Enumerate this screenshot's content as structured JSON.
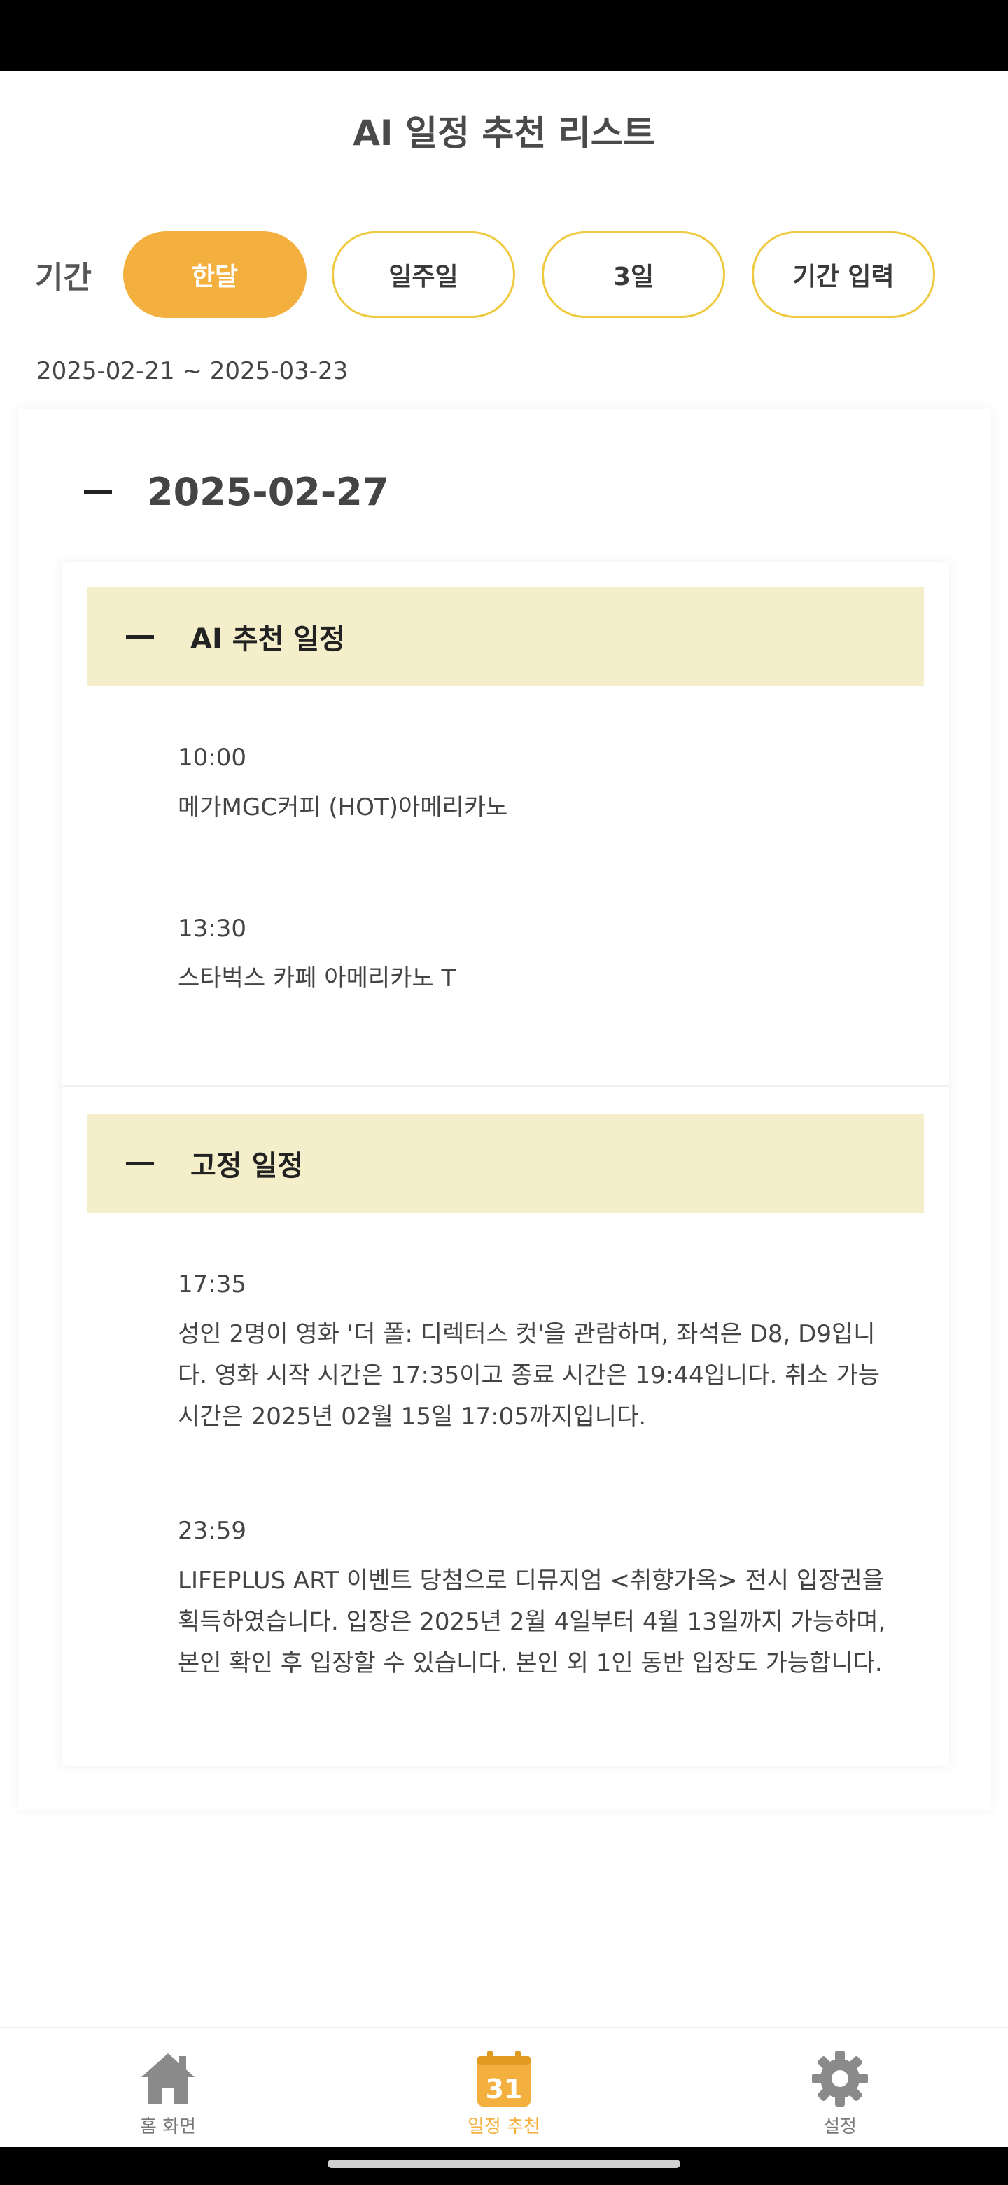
{
  "header": {
    "title": "AI 일정 추천 리스트"
  },
  "period": {
    "label": "기간",
    "options": [
      {
        "label": "한달",
        "active": true
      },
      {
        "label": "일주일",
        "active": false
      },
      {
        "label": "3일",
        "active": false
      },
      {
        "label": "기간 입력",
        "active": false
      }
    ],
    "range_text": "2025-02-21 ~ 2025-03-23"
  },
  "day": {
    "date": "2025-02-27",
    "sections": [
      {
        "title": "AI 추천 일정",
        "items": [
          {
            "time": "10:00",
            "text": "메가MGC커피 (HOT)아메리카노"
          },
          {
            "time": "13:30",
            "text": "스타벅스 카페 아메리카노 T"
          }
        ]
      },
      {
        "title": "고정 일정",
        "items": [
          {
            "time": "17:35",
            "text": "성인 2명이 영화 '더 폴: 디렉터스 컷'을 관람하며, 좌석은 D8, D9입니다. 영화 시작 시간은 17:35이고 종료 시간은 19:44입니다. 취소 가능 시간은 2025년 02월 15일 17:05까지입니다."
          },
          {
            "time": "23:59",
            "text": "LIFEPLUS ART 이벤트 당첨으로 디뮤지엄 <취향가옥> 전시 입장권을 획득하였습니다. 입장은 2025년 2월 4일부터 4월 13일까지 가능하며, 본인 확인 후 입장할 수 있습니다. 본인 외 1인 동반 입장도 가능합니다."
          }
        ]
      }
    ]
  },
  "bottom_nav": {
    "items": [
      {
        "label": "홈 화면",
        "icon": "home-icon",
        "active": false
      },
      {
        "label": "일정 추천",
        "icon": "calendar-icon",
        "calendar_number": "31",
        "active": true
      },
      {
        "label": "설정",
        "icon": "gear-icon",
        "active": false
      }
    ]
  },
  "colors": {
    "accent": "#f4b03f",
    "button_border": "#efc93f",
    "section_bg": "#f4efca",
    "icon_gray": "#8a8a8a"
  }
}
